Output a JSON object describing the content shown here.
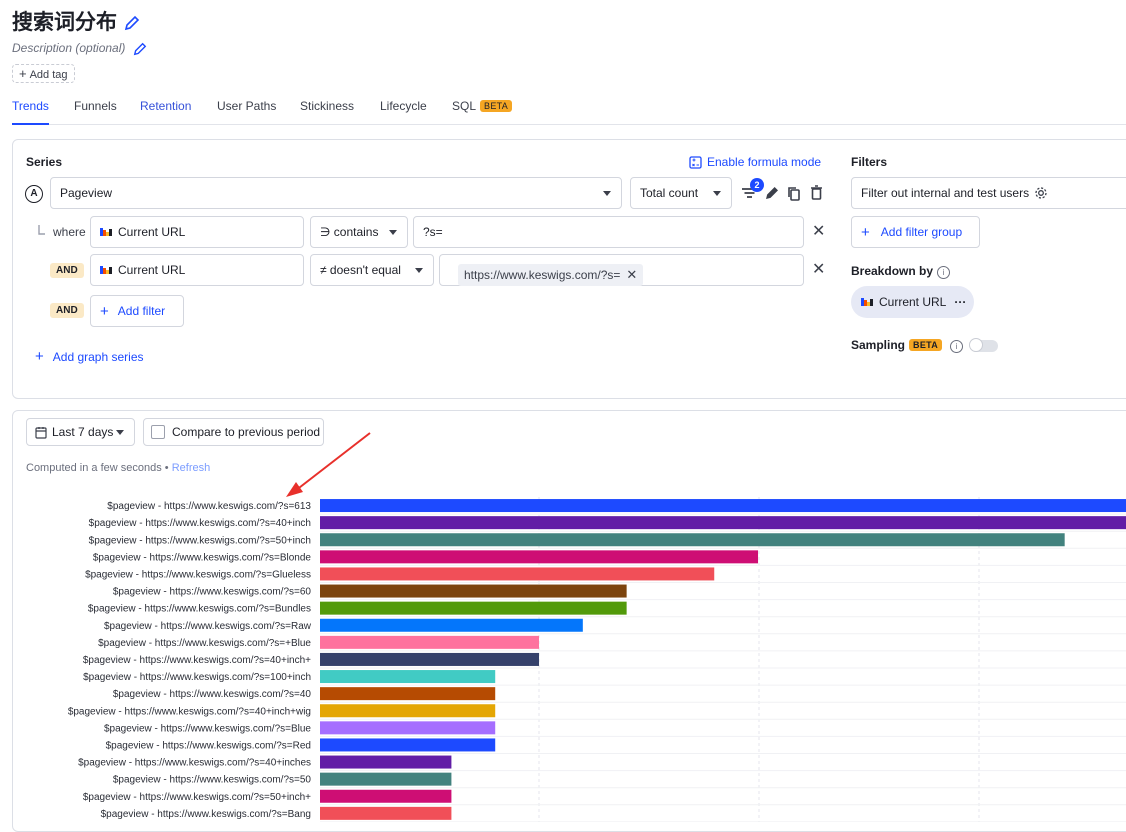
{
  "header": {
    "title": "搜索词分布",
    "description_placeholder": "Description (optional)",
    "add_tag": "Add tag"
  },
  "tabs": [
    {
      "label": "Trends",
      "active": true
    },
    {
      "label": "Funnels"
    },
    {
      "label": "Retention"
    },
    {
      "label": "User Paths"
    },
    {
      "label": "Stickiness"
    },
    {
      "label": "Lifecycle"
    },
    {
      "label": "SQL",
      "badge": "BETA"
    }
  ],
  "series": {
    "label": "Series",
    "formula_link": "Enable formula mode",
    "letter": "A",
    "event": "Pageview",
    "aggregation": "Total count",
    "filter_count": "2",
    "where_label": "where",
    "filters": [
      {
        "prefix": "",
        "property": "Current URL",
        "operator": "∋ contains",
        "value": "?s="
      },
      {
        "prefix": "AND",
        "property": "Current URL",
        "operator": "≠ doesn't equal",
        "value": "https://www.keswigs.com/?s="
      }
    ],
    "and_label": "AND",
    "add_filter": "Add filter",
    "add_graph_series": "Add graph series"
  },
  "filters_panel": {
    "label": "Filters",
    "internal_filter": "Filter out internal and test users",
    "add_filter_group": "Add filter group"
  },
  "breakdown": {
    "label": "Breakdown by",
    "value": "Current URL"
  },
  "sampling": {
    "label": "Sampling",
    "badge": "BETA"
  },
  "controls": {
    "date_range": "Last 7 days",
    "compare": "Compare to previous period",
    "computed": "Computed in a few seconds",
    "refresh": "Refresh"
  },
  "colors": {
    "accent": "#1d4aff",
    "beta": "#f5a623",
    "annotation_arrow": "#e8302b"
  },
  "chart_data": {
    "type": "bar",
    "orientation": "horizontal",
    "categories": [
      "$pageview - https://www.keswigs.com/?s=613",
      "$pageview - https://www.keswigs.com/?s=40+inch",
      "$pageview - https://www.keswigs.com/?s=50+inch",
      "$pageview - https://www.keswigs.com/?s=Blonde",
      "$pageview - https://www.keswigs.com/?s=Glueless",
      "$pageview - https://www.keswigs.com/?s=60",
      "$pageview - https://www.keswigs.com/?s=Bundles",
      "$pageview - https://www.keswigs.com/?s=Raw",
      "$pageview - https://www.keswigs.com/?s=+Blue",
      "$pageview - https://www.keswigs.com/?s=40+inch+",
      "$pageview - https://www.keswigs.com/?s=100+inch",
      "$pageview - https://www.keswigs.com/?s=40",
      "$pageview - https://www.keswigs.com/?s=40+inch+wig",
      "$pageview - https://www.keswigs.com/?s=Blue",
      "$pageview - https://www.keswigs.com/?s=Red",
      "$pageview - https://www.keswigs.com/?s=40+inches",
      "$pageview - https://www.keswigs.com/?s=50",
      "$pageview - https://www.keswigs.com/?s=50+inch+",
      "$pageview - https://www.keswigs.com/?s=Bang"
    ],
    "values": [
      19,
      19,
      17,
      10,
      9,
      7,
      7,
      6,
      5,
      5,
      4,
      4,
      4,
      4,
      4,
      3,
      3,
      3,
      3
    ],
    "colors": [
      "#1d4aff",
      "#621da6",
      "#42827e",
      "#ce0e74",
      "#f14f58",
      "#7c440e",
      "#529a0a",
      "#0476fb",
      "#fe729e",
      "#35416b",
      "#41cbc4",
      "#b64b02",
      "#e4a604",
      "#a56eff",
      "#1d4aff",
      "#621da6",
      "#42827e",
      "#ce0e74",
      "#f14f58"
    ],
    "xlim": [
      0,
      18.4
    ],
    "grid": true
  }
}
